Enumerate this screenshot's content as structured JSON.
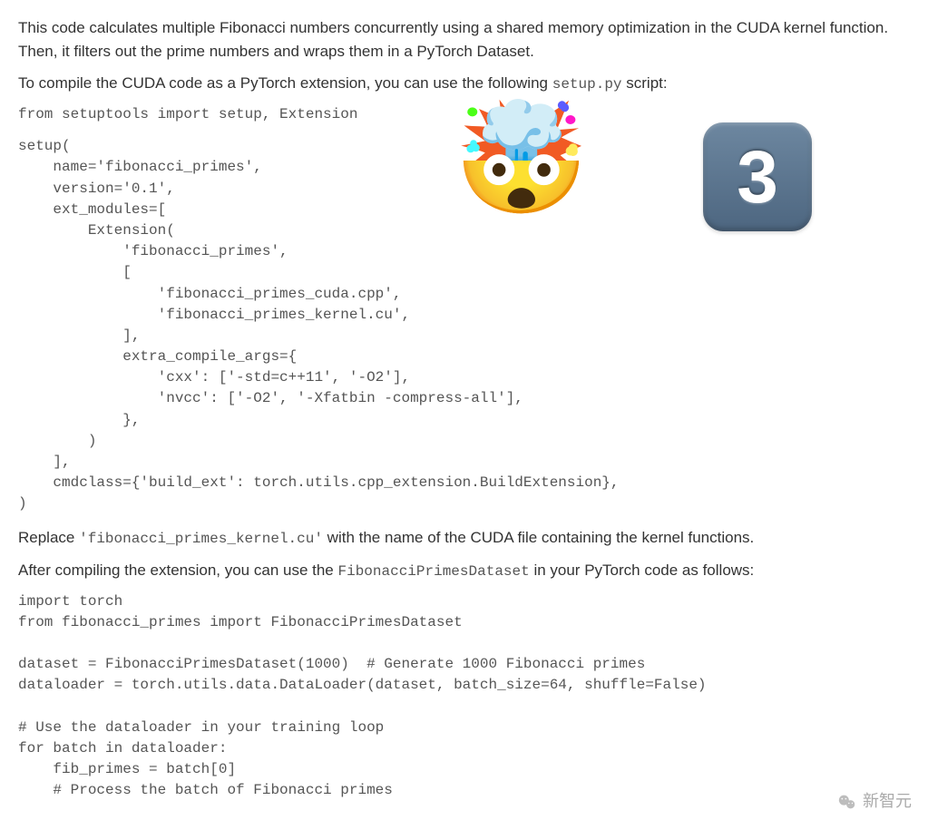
{
  "paragraphs": {
    "p1": "This code calculates multiple Fibonacci numbers concurrently using a shared memory optimization in the CUDA kernel function. Then, it filters out the prime numbers and wraps them in a PyTorch Dataset.",
    "p2_pre": "To compile the CUDA code as a PyTorch extension, you can use the following ",
    "p2_code": "setup.py",
    "p2_post": " script:",
    "p3_pre": "Replace ",
    "p3_code": "'fibonacci_primes_kernel.cu'",
    "p3_post": " with the name of the CUDA file containing the kernel functions.",
    "p4_pre": "After compiling the extension, you can use the ",
    "p4_code": "FibonacciPrimesDataset",
    "p4_post": " in your PyTorch code as follows:"
  },
  "code": {
    "import_line": "from setuptools import setup, Extension",
    "setup_block": "setup(\n    name='fibonacci_primes',\n    version='0.1',\n    ext_modules=[\n        Extension(\n            'fibonacci_primes',\n            [\n                'fibonacci_primes_cuda.cpp',\n                'fibonacci_primes_kernel.cu',\n            ],\n            extra_compile_args={\n                'cxx': ['-std=c++11', '-O2'],\n                'nvcc': ['-O2', '-Xfatbin -compress-all'],\n            },\n        )\n    ],\n    cmdclass={'build_ext': torch.utils.cpp_extension.BuildExtension},\n)",
    "usage_block": "import torch\nfrom fibonacci_primes import FibonacciPrimesDataset\n\ndataset = FibonacciPrimesDataset(1000)  # Generate 1000 Fibonacci primes\ndataloader = torch.utils.data.DataLoader(dataset, batch_size=64, shuffle=False)\n\n# Use the dataloader in your training loop\nfor batch in dataloader:\n    fib_primes = batch[0]\n    # Process the batch of Fibonacci primes"
  },
  "overlay": {
    "emoji": "🤯",
    "badge_digit": "3"
  },
  "watermark": {
    "text": "新智元"
  }
}
